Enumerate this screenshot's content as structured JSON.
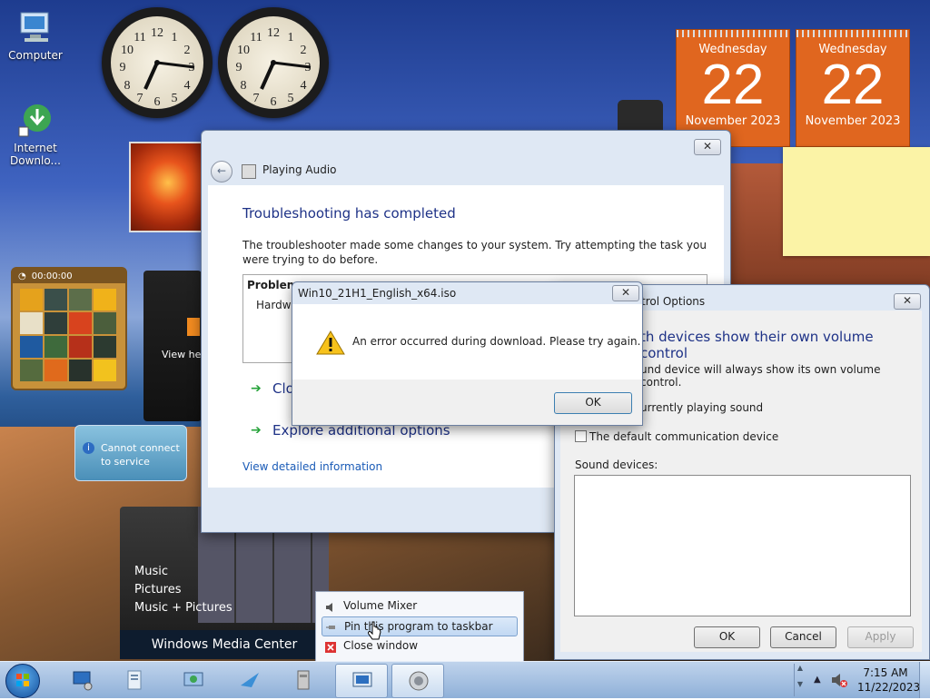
{
  "desktop": {
    "icons": [
      {
        "label": "Computer",
        "icon": "computer-icon"
      },
      {
        "label": "Internet Downlo...",
        "icon": "internet-download-manager-icon"
      }
    ],
    "clocks": [
      {
        "numbers": [
          "12",
          "1",
          "2",
          "3",
          "4",
          "5",
          "6",
          "7",
          "8",
          "9",
          "10",
          "11"
        ]
      },
      {
        "numbers": [
          "12",
          "1",
          "2",
          "3",
          "4",
          "5",
          "6",
          "7",
          "8",
          "9",
          "10",
          "11"
        ]
      }
    ],
    "calendars": [
      {
        "weekday": "Wednesday",
        "day": "22",
        "month": "November 2023"
      },
      {
        "weekday": "Wednesday",
        "day": "22",
        "month": "November 2023"
      }
    ],
    "puzzle": {
      "timer": "00:00:00"
    },
    "feed": {
      "text": "View he"
    },
    "weather": {
      "message": "Cannot connect to service"
    },
    "media_center": {
      "items": [
        "Music",
        "Pictures",
        "Music + Pictures"
      ],
      "brand": "Windows Media Center"
    }
  },
  "troubleshooter": {
    "title": "Playing Audio",
    "heading": "Troubleshooting has completed",
    "description": "The troubleshooter made some changes to your system. Try attempting the task you were trying to do before.",
    "problems_header": "Problems",
    "problem_item": "Hardwa",
    "options": [
      "Clo",
      "Explore additional options"
    ],
    "link": "View detailed information",
    "close_glyph": "✕"
  },
  "sound_dialog": {
    "title": "trol Options",
    "heading": "th devices show their own volume control",
    "line1": "und device will always show its own volume control.",
    "line2": "urrently playing sound",
    "checkbox_label": "The default communication device",
    "devices_label": "Sound devices:",
    "buttons": {
      "ok": "OK",
      "cancel": "Cancel",
      "apply": "Apply"
    },
    "close_glyph": "✕"
  },
  "error_dialog": {
    "title": "Win10_21H1_English_x64.iso",
    "message": "An error occurred during download. Please try again.",
    "ok": "OK",
    "close_glyph": "✕"
  },
  "jumplist": {
    "items": [
      {
        "label": "Volume Mixer",
        "icon": "speaker-icon"
      },
      {
        "label": "Pin this program to taskbar",
        "icon": "pin-icon",
        "highlighted": true
      },
      {
        "label": "Close window",
        "icon": "close-window-icon"
      }
    ]
  },
  "taskbar": {
    "buttons": [
      "network-computer-icon",
      "documents-icon",
      "network-icon",
      "messenger-icon",
      "archive-icon",
      "display-icon",
      "speaker-icon"
    ],
    "active_buttons": [
      "display-icon",
      "speaker-icon"
    ],
    "time": "7:15 AM",
    "date": "11/22/2023"
  },
  "colors": {
    "accent_blue": "#1e3287",
    "link_blue": "#1a5bb7",
    "calendar_orange": "#e0661f",
    "sticky_yellow": "#fbf3a6"
  }
}
